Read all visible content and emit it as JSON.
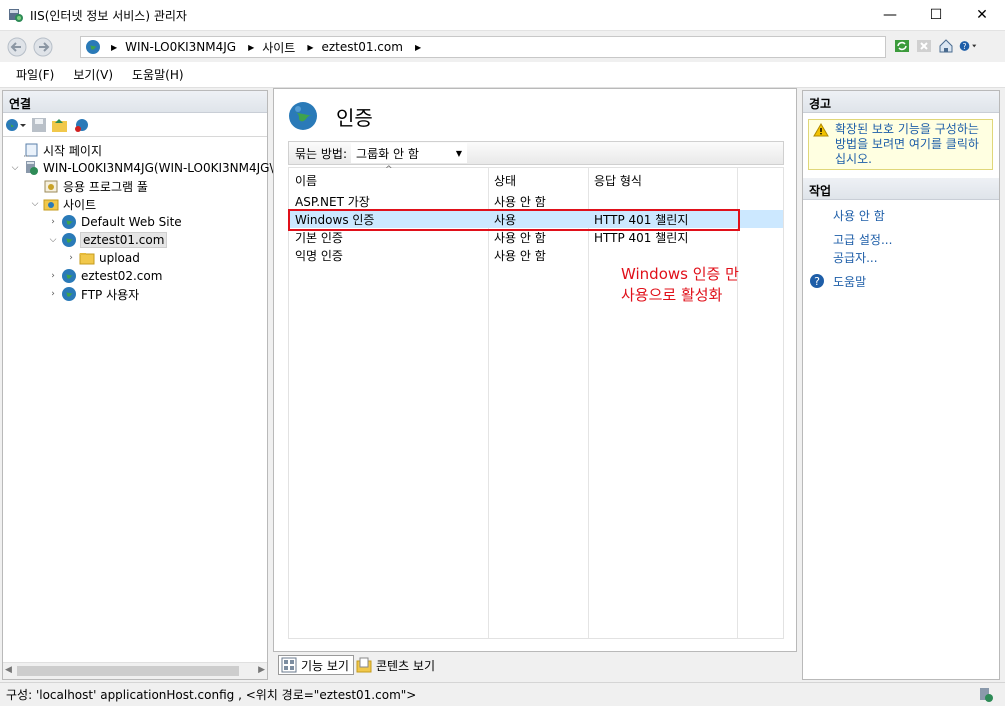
{
  "window": {
    "title": "IIS(인터넷 정보 서비스) 관리자",
    "minimize": "—",
    "maximize": "☐",
    "close": "✕"
  },
  "address": {
    "segments": [
      "WIN-LO0KI3NM4JG",
      "사이트",
      "eztest01.com"
    ]
  },
  "menu": {
    "file": "파일(F)",
    "view": "보기(V)",
    "help": "도움말(H)"
  },
  "connections": {
    "header": "연결",
    "tree": [
      {
        "label": "시작 페이지",
        "icon": "start-page-icon"
      },
      {
        "label": "WIN-LO0KI3NM4JG(WIN-LO0KI3NM4JG\\",
        "icon": "server-icon"
      },
      {
        "label": "응용 프로그램 풀",
        "icon": "app-pool-icon"
      },
      {
        "label": "사이트",
        "icon": "sites-folder-icon"
      },
      {
        "label": "Default Web Site",
        "icon": "globe-icon"
      },
      {
        "label": "eztest01.com",
        "icon": "globe-icon"
      },
      {
        "label": "upload",
        "icon": "folder-icon"
      },
      {
        "label": "eztest02.com",
        "icon": "globe-icon"
      },
      {
        "label": "FTP 사용자",
        "icon": "globe-icon"
      }
    ]
  },
  "feature": {
    "title": "인증",
    "group_by_label": "묶는 방법:",
    "group_by_value": "그룹화 안 함",
    "columns": [
      "이름",
      "상태",
      "응답 형식"
    ],
    "rows": [
      {
        "name": "ASP.NET 가장",
        "status": "사용 안 함",
        "response": ""
      },
      {
        "name": "Windows 인증",
        "status": "사용",
        "response": "HTTP 401 챌린지"
      },
      {
        "name": "기본 인증",
        "status": "사용 안 함",
        "response": "HTTP 401 챌린지"
      },
      {
        "name": "익명 인증",
        "status": "사용 안 함",
        "response": ""
      }
    ],
    "annotation_line1": "Windows 인증 만",
    "annotation_line2": "사용으로 활성화",
    "annotation_color": "#e0101a"
  },
  "view_tabs": {
    "features": "기능 보기",
    "content": "콘텐츠 보기"
  },
  "alerts": {
    "header": "경고",
    "message": "확장된 보호 기능을 구성하는 방법을 보려면 여기를 클릭하십시오."
  },
  "actions": {
    "header": "작업",
    "disable": "사용 안 함",
    "advanced": "고급 설정...",
    "providers": "공급자...",
    "help": "도움말"
  },
  "status": {
    "text": "구성: 'localhost' applicationHost.config , <위치 경로=\"eztest01.com\">"
  }
}
